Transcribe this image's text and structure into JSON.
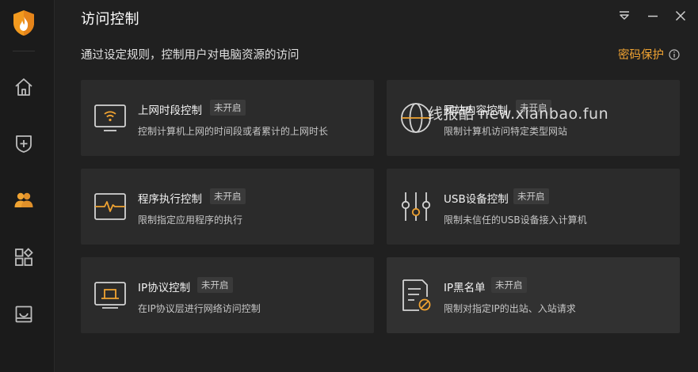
{
  "window": {
    "title": "访问控制"
  },
  "header": {
    "subtitle": "通过设定规则，控制用户对电脑资源的访问",
    "password_protect_label": "密码保护"
  },
  "sidebar": {
    "items": [
      {
        "name": "home",
        "icon": "home-icon"
      },
      {
        "name": "shield",
        "icon": "shield-plus-icon"
      },
      {
        "name": "users",
        "icon": "users-icon",
        "active": true
      },
      {
        "name": "apps",
        "icon": "apps-icon"
      },
      {
        "name": "box",
        "icon": "box-icon"
      }
    ]
  },
  "cards": [
    {
      "title": "上网时段控制",
      "badge": "未开启",
      "desc": "控制计算机上网的时间段或者累计的上网时长",
      "icon": "monitor-wifi-icon"
    },
    {
      "title": "网站内容控制",
      "badge": "未开启",
      "desc": "限制计算机访问特定类型网站",
      "icon": "globe-icon"
    },
    {
      "title": "程序执行控制",
      "badge": "未开启",
      "desc": "限制指定应用程序的执行",
      "icon": "pulse-window-icon"
    },
    {
      "title": "USB设备控制",
      "badge": "未开启",
      "desc": "限制未信任的USB设备接入计算机",
      "icon": "sliders-icon"
    },
    {
      "title": "IP协议控制",
      "badge": "未开启",
      "desc": "在IP协议层进行网络访问控制",
      "icon": "monitor-ip-icon"
    },
    {
      "title": "IP黑名单",
      "badge": "未开启",
      "desc": "限制对指定IP的出站、入站请求",
      "icon": "document-block-icon"
    }
  ],
  "watermark": "线报酷 new.xianbao.fun",
  "colors": {
    "accent": "#f0a332",
    "background": "#202020",
    "card": "#2b2b2b"
  }
}
